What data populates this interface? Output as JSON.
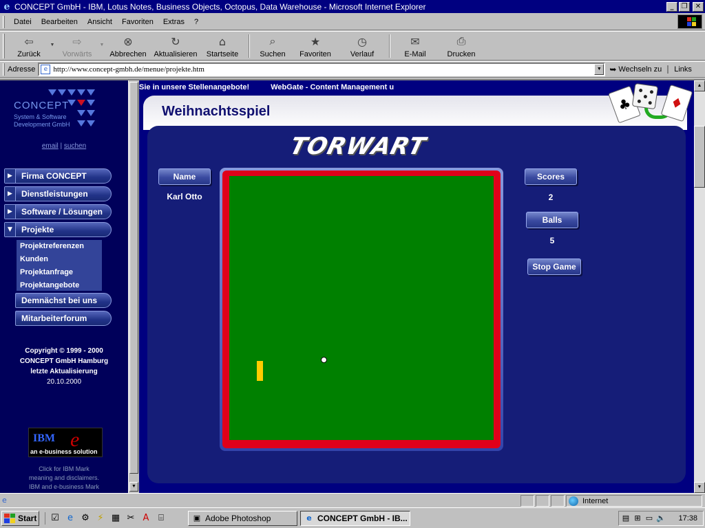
{
  "window": {
    "title": "CONCEPT GmbH - IBM, Lotus Notes, Business Objects, Octopus, Data Warehouse - Microsoft Internet Explorer"
  },
  "menu": [
    "Datei",
    "Bearbeiten",
    "Ansicht",
    "Favoriten",
    "Extras",
    "?"
  ],
  "toolbar": {
    "back": "Zurück",
    "forward": "Vorwärts",
    "stop": "Abbrechen",
    "refresh": "Aktualisieren",
    "home": "Startseite",
    "search": "Suchen",
    "favorites": "Favoriten",
    "history": "Verlauf",
    "mail": "E-Mail",
    "print": "Drucken"
  },
  "address": {
    "label": "Adresse",
    "url": "http://www.concept-gmbh.de/menue/projekte.htm",
    "go": "Wechseln zu",
    "links": "Links"
  },
  "sidebar": {
    "logo_name": "CONCEPT",
    "logo_sub1": "System & Software",
    "logo_sub2": "Development GmbH",
    "email": "email",
    "sep": "|",
    "search": "suchen",
    "nav": [
      {
        "label": "Firma CONCEPT",
        "icon": "play-right"
      },
      {
        "label": "Dienstleistungen",
        "icon": "play-right"
      },
      {
        "label": "Software / Lösungen",
        "icon": "play-right"
      },
      {
        "label": "Projekte",
        "icon": "play-down"
      }
    ],
    "subnav": [
      "Projektreferenzen",
      "Kunden",
      "Projektanfrage",
      "Projektangebote"
    ],
    "extra": [
      "Demnächst bei uns",
      "Mitarbeiterforum"
    ],
    "copyright1": "Copyright © 1999 - 2000",
    "copyright2": "CONCEPT GmbH Hamburg",
    "copyright3": "letzte Aktualisierung",
    "copyright4": "20.10.2000",
    "ibm_text": "IBM",
    "ibm_tag": "an e-business solution",
    "ibm_note1": "Click for IBM Mark",
    "ibm_note2": "meaning and disclaimers.",
    "ibm_note3": "IBM and e-business Mark"
  },
  "main": {
    "ticker": [
      "Sie in unsere Stellenangebote!",
      "WebGate - Content Management u"
    ],
    "page_title": "Weihnachtsspiel",
    "game_logo": "TORWART",
    "name_label": "Name",
    "player_name": "Karl Otto",
    "scores_label": "Scores",
    "scores": "2",
    "balls_label": "Balls",
    "balls": "5",
    "stop_button": "Stop Game"
  },
  "statusbar": {
    "zone": "Internet"
  },
  "taskbar": {
    "start": "Start",
    "tasks": [
      "Adobe Photoshop",
      "CONCEPT GmbH - IB..."
    ],
    "clock": "17:38"
  },
  "colors": {
    "titlebar": "#000080",
    "content_bg": "#000080",
    "field_green": "#008000",
    "field_border": "#e0001a",
    "goalkeeper": "#ffcc00"
  }
}
